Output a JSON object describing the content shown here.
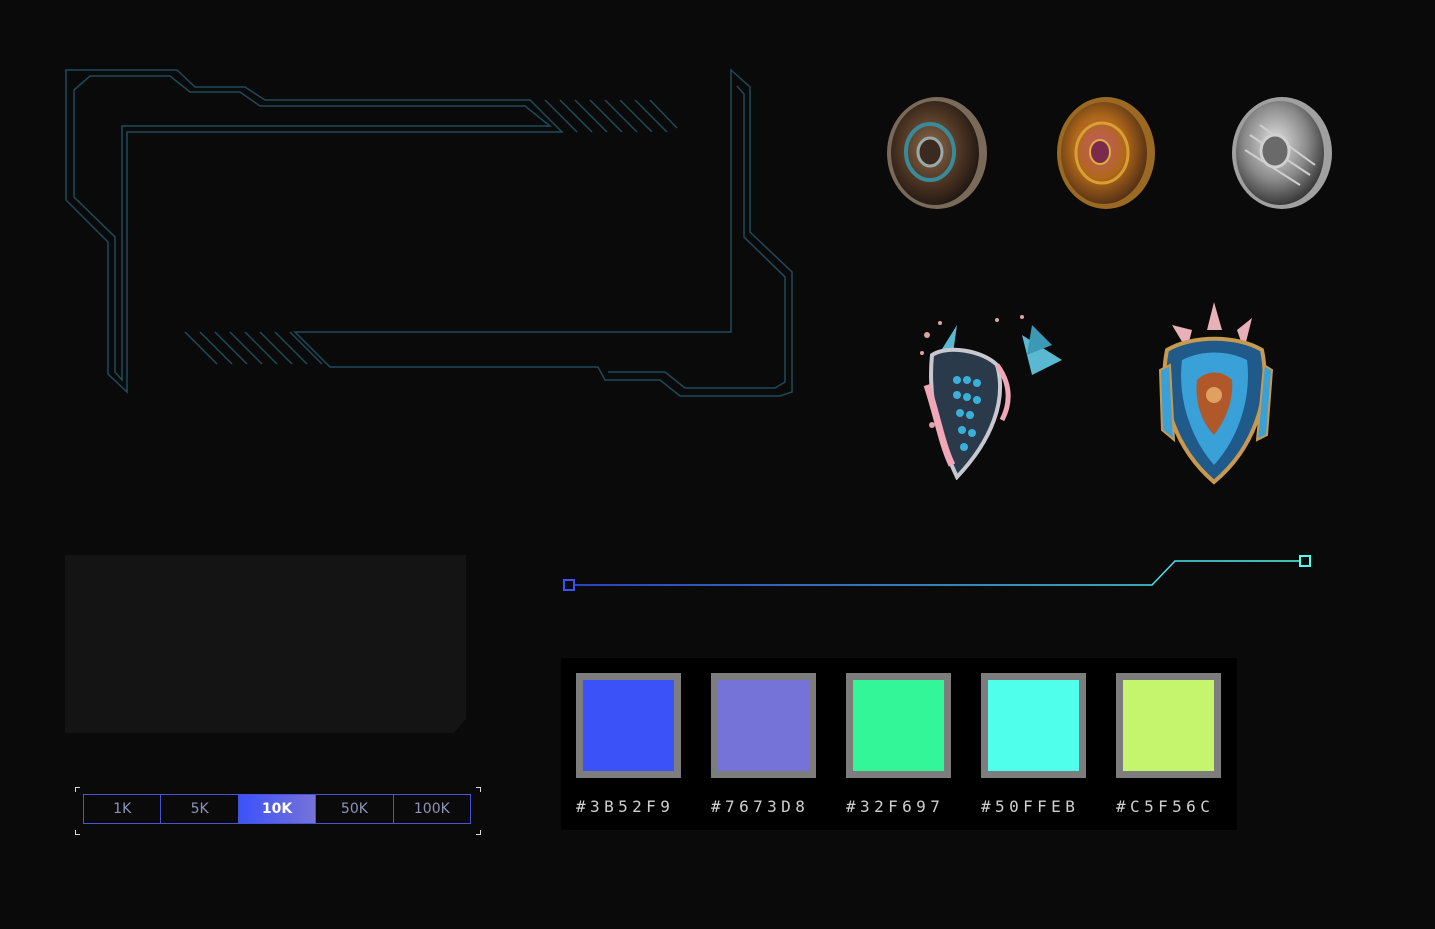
{
  "amounts": {
    "options": [
      "1K",
      "5K",
      "10K",
      "50K",
      "100K"
    ],
    "selected": "10K"
  },
  "palette": {
    "swatches": [
      {
        "hex": "#3B52F9",
        "label": "#3B52F9"
      },
      {
        "hex": "#7673D8",
        "label": "#7673D8"
      },
      {
        "hex": "#32F697",
        "label": "#32F697"
      },
      {
        "hex": "#50FFEB",
        "label": "#50FFEB"
      },
      {
        "hex": "#C5F56C",
        "label": "#C5F56C"
      }
    ]
  },
  "colors": {
    "background": "#0a0a0a",
    "hud_line": "#1e4a5a",
    "panel": "#141414",
    "accent_start": "#3B52F9",
    "accent_end": "#50FFEB"
  },
  "icons": {
    "shields": [
      "bronze-round-shield-icon",
      "gold-round-shield-icon",
      "silver-round-shield-icon",
      "spiked-kite-shield-icon",
      "ornate-kite-shield-icon"
    ]
  }
}
